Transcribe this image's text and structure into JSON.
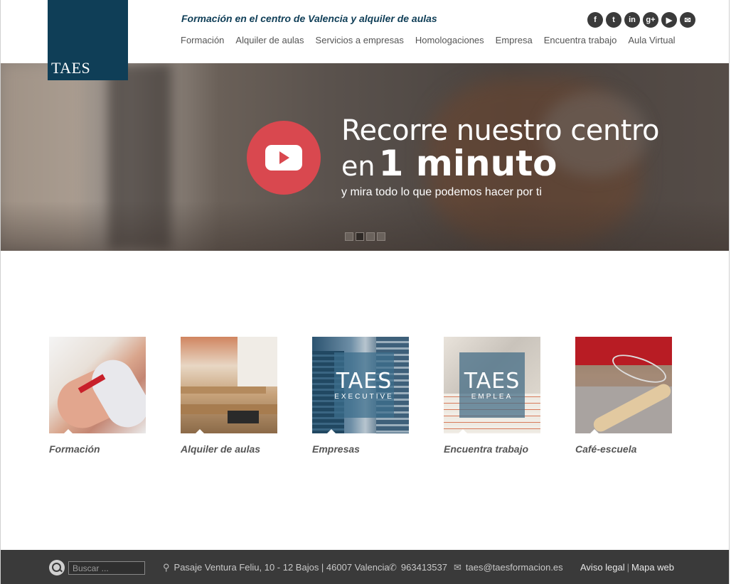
{
  "brand": {
    "logo_text": "TAES",
    "tagline": "Formación en el centro de Valencia y alquiler de aulas"
  },
  "social": [
    {
      "icon": "facebook-icon",
      "glyph": "f"
    },
    {
      "icon": "twitter-icon",
      "glyph": "t"
    },
    {
      "icon": "linkedin-icon",
      "glyph": "in"
    },
    {
      "icon": "googleplus-icon",
      "glyph": "g+"
    },
    {
      "icon": "youtube-icon",
      "glyph": "▶"
    },
    {
      "icon": "email-icon",
      "glyph": "✉"
    }
  ],
  "nav": {
    "formacion": "Formación",
    "alquiler": "Alquiler de aulas",
    "servicios": "Servicios a empresas",
    "homologaciones": "Homologaciones",
    "empresa": "Empresa",
    "encuentra": "Encuentra trabajo",
    "aula": "Aula Virtual"
  },
  "hero": {
    "line1": "Recorre nuestro centro",
    "line2_prefix": "en",
    "line2_big": "1 minuto",
    "line3": "y mira todo lo que podemos hacer por ti",
    "slide_count": 4,
    "active_slide": 2
  },
  "cards": {
    "formacion": "Formación",
    "aulas": "Alquiler de aulas",
    "empresas": "Empresas",
    "trabajo": "Encuentra trabajo",
    "cafe": "Café-escuela",
    "executive_main": "TAES",
    "executive_sub": "EXECUTIVE",
    "emplea_main": "TAES",
    "emplea_sub": "EMPLEA"
  },
  "footer": {
    "search_placeholder": "Buscar ...",
    "address": "Pasaje Ventura Feliu, 10 - 12 Bajos | 46007 Valencia",
    "phone": "963413537",
    "email": "taes@taesformacion.es",
    "legal": "Aviso legal",
    "sep": "|",
    "sitemap": "Mapa web"
  },
  "colors": {
    "brand_blue": "#0f3e57",
    "play_red": "#d9484f",
    "footer_bg": "#3a3a3a"
  }
}
